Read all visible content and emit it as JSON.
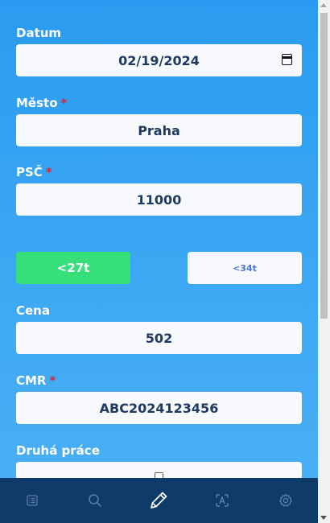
{
  "form": {
    "datum": {
      "label": "Datum",
      "value": "02/19/2024",
      "required": false
    },
    "mesto": {
      "label": "Město",
      "value": "Praha",
      "required": true
    },
    "psc": {
      "label": "PSČ",
      "value": "11000",
      "required": true
    },
    "tonnage": {
      "options": [
        "<27t",
        "<34t"
      ],
      "selected": "<27t"
    },
    "cena": {
      "label": "Cena",
      "value": "502",
      "required": false
    },
    "cmr": {
      "label": "CMR",
      "value": "ABC2024123456",
      "required": true
    },
    "druha_prace": {
      "label": "Druhá práce",
      "checked": false
    }
  },
  "required_marker": "*",
  "nav": {
    "items": [
      {
        "icon": "list-icon",
        "active": false
      },
      {
        "icon": "search-icon",
        "active": false
      },
      {
        "icon": "pencil-icon",
        "active": true
      },
      {
        "icon": "text-scan-icon",
        "active": false
      },
      {
        "icon": "gear-icon",
        "active": false
      }
    ]
  },
  "colors": {
    "background": "#3aa6f3",
    "field_text": "#1e3a63",
    "required": "#e0252f",
    "active_button": "#35e07a",
    "inactive_button_text": "#4e74d9",
    "nav_bar": "#0f3b6b"
  }
}
